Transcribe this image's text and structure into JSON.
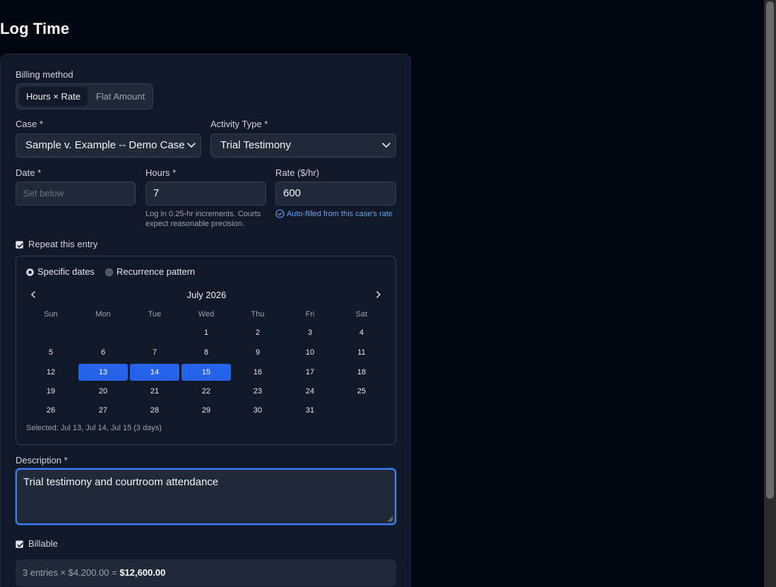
{
  "page": {
    "title": "Log Time"
  },
  "billing": {
    "label": "Billing method",
    "options": [
      "Hours × Rate",
      "Flat Amount"
    ],
    "selected": "Hours × Rate"
  },
  "case": {
    "label": "Case *",
    "value": "Sample v. Example -- Demo Case"
  },
  "activity": {
    "label": "Activity Type *",
    "value": "Trial Testimony"
  },
  "date": {
    "label": "Date *",
    "placeholder": "Set below"
  },
  "hours": {
    "label": "Hours *",
    "value": "7",
    "help_line1": "Log in 0.25-hr increments. Courts",
    "help_line2": "expect reasonable precision."
  },
  "rate": {
    "label": "Rate ($/hr)",
    "value": "600",
    "note": "Auto-filled from this case's rate"
  },
  "repeat": {
    "label": "Repeat this entry",
    "checked": true,
    "mode_specific": "Specific dates",
    "mode_pattern": "Recurrence pattern",
    "mode_selected": "Specific dates"
  },
  "calendar": {
    "month": "July 2026",
    "weekdays": [
      "Sun",
      "Mon",
      "Tue",
      "Wed",
      "Thu",
      "Fri",
      "Sat"
    ],
    "weeks": [
      [
        "",
        "",
        "",
        "1",
        "2",
        "3",
        "4"
      ],
      [
        "5",
        "6",
        "7",
        "8",
        "9",
        "10",
        "11"
      ],
      [
        "12",
        "13",
        "14",
        "15",
        "16",
        "17",
        "18"
      ],
      [
        "19",
        "20",
        "21",
        "22",
        "23",
        "24",
        "25"
      ],
      [
        "26",
        "27",
        "28",
        "29",
        "30",
        "31",
        ""
      ]
    ],
    "selected_days": [
      "13",
      "14",
      "15"
    ],
    "selected_text": "Selected: Jul 13, Jul 14, Jul 15 (3 days)"
  },
  "description": {
    "label": "Description *",
    "value": "Trial testimony and courtroom attendance"
  },
  "billable": {
    "label": "Billable",
    "checked": true
  },
  "summary": {
    "prefix": "3 entries × $4,200.00 = ",
    "total": "$12,600.00"
  }
}
